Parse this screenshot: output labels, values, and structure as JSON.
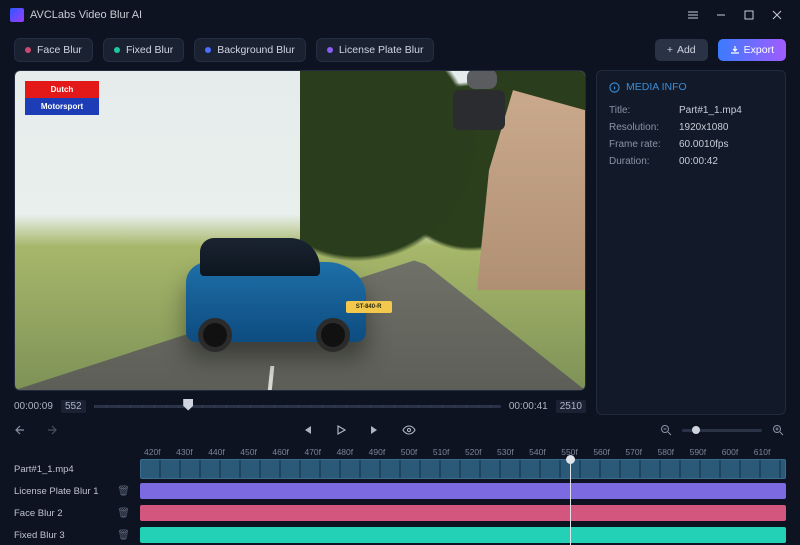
{
  "app": {
    "title": "AVCLabs Video Blur AI"
  },
  "toolbar": {
    "face": "Face Blur",
    "fixed": "Fixed Blur",
    "background": "Background Blur",
    "license": "License Plate Blur",
    "add": "Add",
    "export": "Export"
  },
  "preview": {
    "badge_top": "Dutch",
    "badge_bottom": "Motorsport",
    "plate": "ST-840-R"
  },
  "seek": {
    "left_time": "00:00:09",
    "left_frame": "552",
    "right_time": "00:00:41",
    "right_frame": "2510"
  },
  "media_info": {
    "header": "MEDIA INFO",
    "title_k": "Title:",
    "title_v": "Part#1_1.mp4",
    "res_k": "Resolution:",
    "res_v": "1920x1080",
    "fps_k": "Frame rate:",
    "fps_v": "60.0010fps",
    "dur_k": "Duration:",
    "dur_v": "00:00:42"
  },
  "ruler": [
    "420f",
    "430f",
    "440f",
    "450f",
    "460f",
    "470f",
    "480f",
    "490f",
    "500f",
    "510f",
    "520f",
    "530f",
    "540f",
    "550f",
    "560f",
    "570f",
    "580f",
    "590f",
    "600f",
    "610f"
  ],
  "tracks": {
    "video": "Part#1_1.mp4",
    "license": "License Plate Blur 1",
    "face": "Face Blur 2",
    "fixed": "Fixed Blur 3"
  }
}
